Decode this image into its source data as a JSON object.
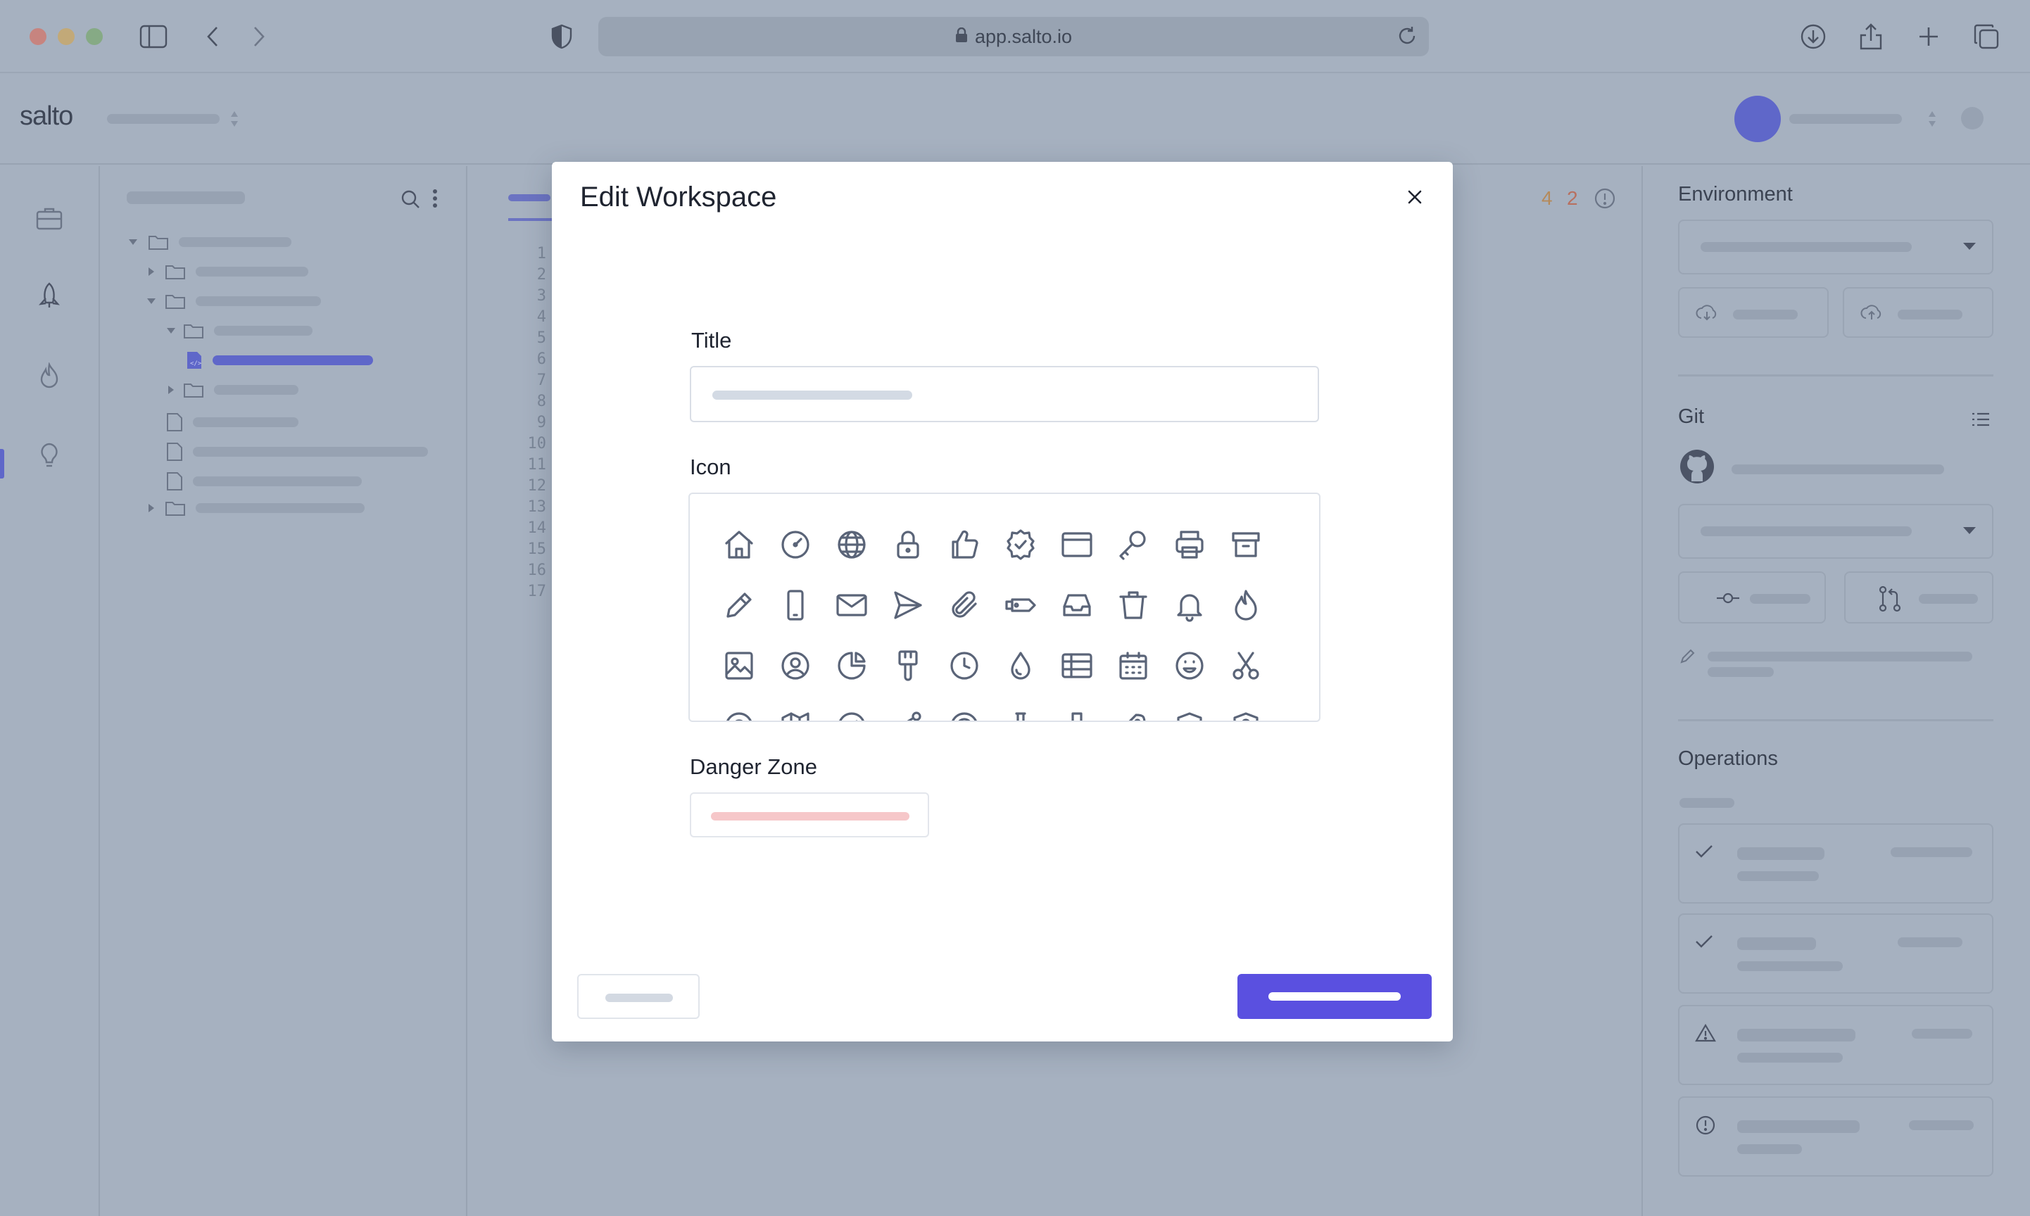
{
  "browser": {
    "url": "app.salto.io"
  },
  "app": {
    "logo": "salto"
  },
  "editor": {
    "line_numbers": [
      "1",
      "2",
      "3",
      "4",
      "5",
      "6",
      "7",
      "8",
      "9",
      "10",
      "11",
      "12",
      "13",
      "14",
      "15",
      "16",
      "17"
    ],
    "error_count": "4",
    "warning_count": "2"
  },
  "right_panel": {
    "environment_heading": "Environment",
    "git_heading": "Git",
    "operations_heading": "Operations"
  },
  "modal": {
    "title": "Edit Workspace",
    "title_field_label": "Title",
    "title_value": "",
    "icon_field_label": "Icon",
    "danger_zone_label": "Danger Zone",
    "icons": [
      "home-icon",
      "dashboard-gauge-icon",
      "globe-icon",
      "lock-icon",
      "thumbs-up-icon",
      "badge-check-icon",
      "browser-window-icon",
      "key-icon",
      "printer-icon",
      "archive-icon",
      "pencil-icon",
      "mobile-device-icon",
      "envelope-icon",
      "send-icon",
      "paperclip-icon",
      "tag-icon",
      "inbox-icon",
      "trash-icon",
      "bell-icon",
      "fire-icon",
      "image-icon",
      "user-circle-icon",
      "pie-chart-icon",
      "paint-brush-icon",
      "clock-icon",
      "water-drop-icon",
      "table-icon",
      "calendar-icon",
      "smiley-icon",
      "scissors-icon",
      "life-buoy-icon",
      "map-icon",
      "compass-icon",
      "share-nodes-icon",
      "target-icon",
      "flask-icon",
      "pin-icon",
      "rocket-icon",
      "shield-icon",
      "user-lock-icon"
    ]
  },
  "colors": {
    "primary": "#5a50e0",
    "overlay": "#a6b1c0",
    "icon_stroke": "#5a6478",
    "danger_placeholder": "#f6c7c9"
  }
}
